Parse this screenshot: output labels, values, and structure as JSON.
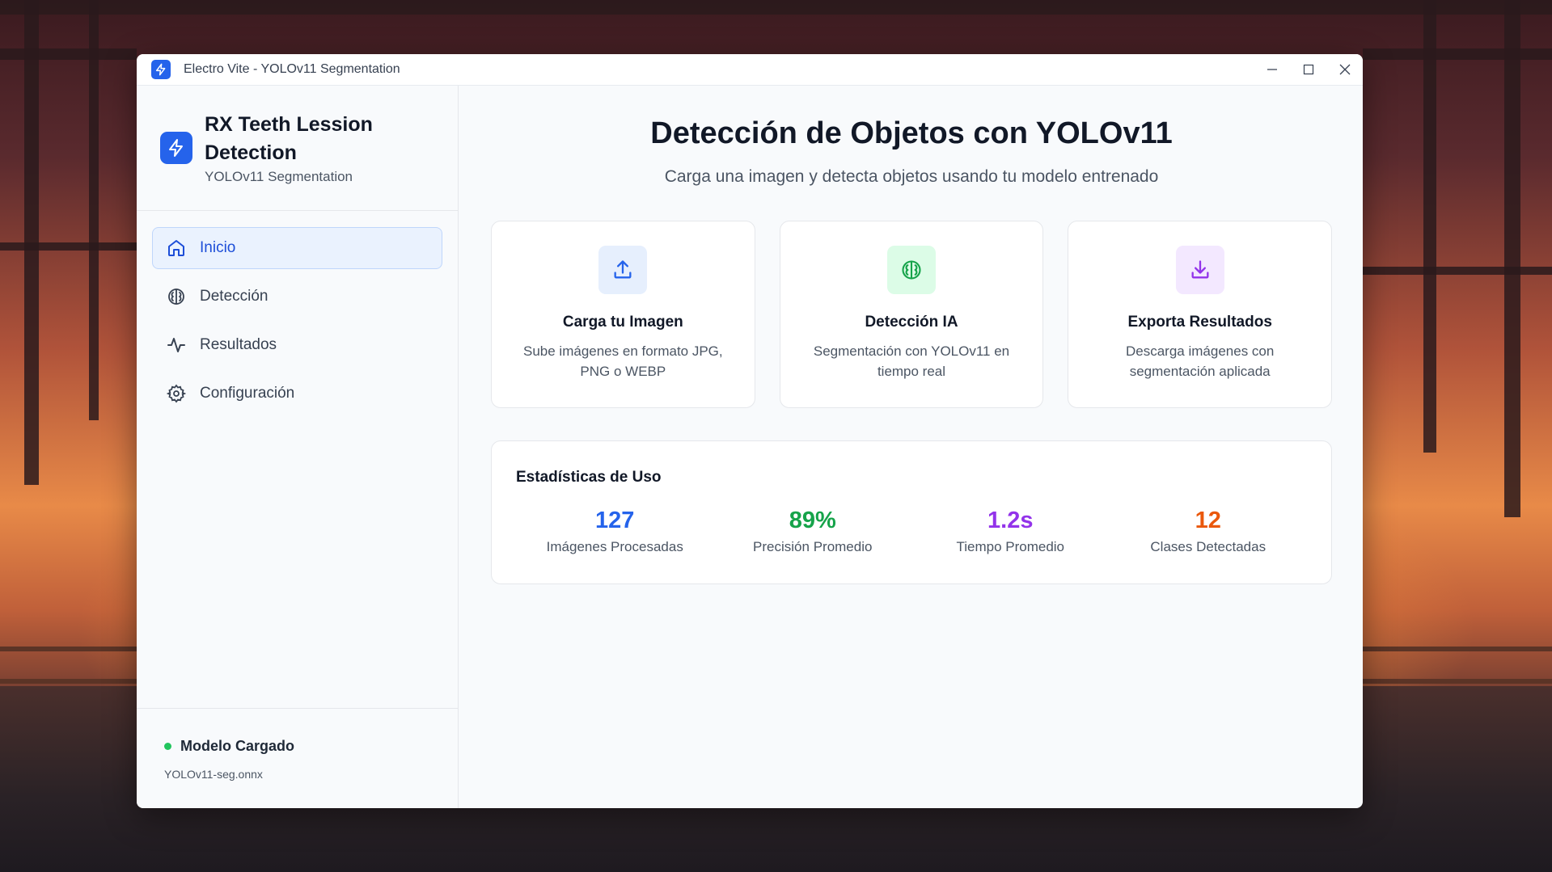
{
  "window": {
    "title": "Electro Vite - YOLOv11 Segmentation"
  },
  "sidebar": {
    "brand_title": "RX Teeth Lession Detection",
    "brand_subtitle": "YOLOv11 Segmentation",
    "items": [
      {
        "label": "Inicio",
        "icon": "home-icon",
        "active": true
      },
      {
        "label": "Detección",
        "icon": "brain-icon",
        "active": false
      },
      {
        "label": "Resultados",
        "icon": "activity-icon",
        "active": false
      },
      {
        "label": "Configuración",
        "icon": "gear-icon",
        "active": false
      }
    ],
    "status_label": "Modelo Cargado",
    "status_file": "YOLOv11-seg.onnx"
  },
  "main": {
    "title": "Detección de Objetos con YOLOv11",
    "subtitle": "Carga una imagen y detecta objetos usando tu modelo entrenado",
    "cards": [
      {
        "title": "Carga tu Imagen",
        "desc": "Sube imágenes en formato JPG, PNG o WEBP",
        "icon": "upload-icon",
        "color": "#2563eb",
        "bg": "#e6effd"
      },
      {
        "title": "Detección IA",
        "desc": "Segmentación con YOLOv11 en tiempo real",
        "icon": "brain-icon",
        "color": "#16a34a",
        "bg": "#dcfce7"
      },
      {
        "title": "Exporta Resultados",
        "desc": "Descarga imágenes con segmentación aplicada",
        "icon": "download-icon",
        "color": "#9333ea",
        "bg": "#f3e8ff"
      }
    ],
    "stats_title": "Estadísticas de Uso",
    "stats": [
      {
        "value": "127",
        "label": "Imágenes Procesadas",
        "color": "#2563eb"
      },
      {
        "value": "89%",
        "label": "Precisión Promedio",
        "color": "#16a34a"
      },
      {
        "value": "1.2s",
        "label": "Tiempo Promedio",
        "color": "#9333ea"
      },
      {
        "value": "12",
        "label": "Clases Detectadas",
        "color": "#ea580c"
      }
    ]
  }
}
